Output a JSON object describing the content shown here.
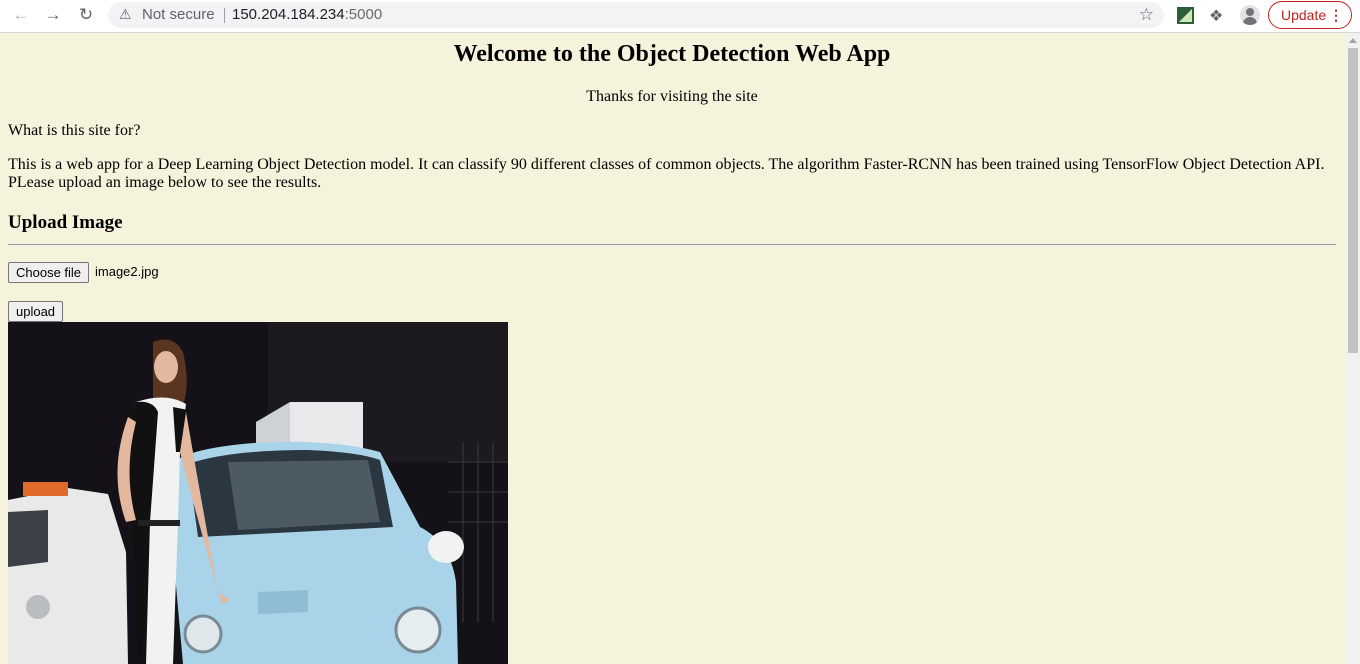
{
  "browser": {
    "warning_label": "Not secure",
    "url_host": "150.204.184.234",
    "url_port": ":5000",
    "update_label": "Update"
  },
  "page": {
    "title": "Welcome to the Object Detection Web App",
    "subtitle": "Thanks for visiting the site",
    "question": "What is this site for?",
    "description": "This is a web app for a Deep Learning Object Detection model. It can classify 90 different classes of common objects. The algorithm Faster-RCNN has been trained using TensorFlow Object Detection API. PLease upload an image below to see the results.",
    "upload_heading": "Upload Image",
    "choose_file_label": "Choose file",
    "selected_file": "image2.jpg",
    "upload_button": "upload"
  }
}
